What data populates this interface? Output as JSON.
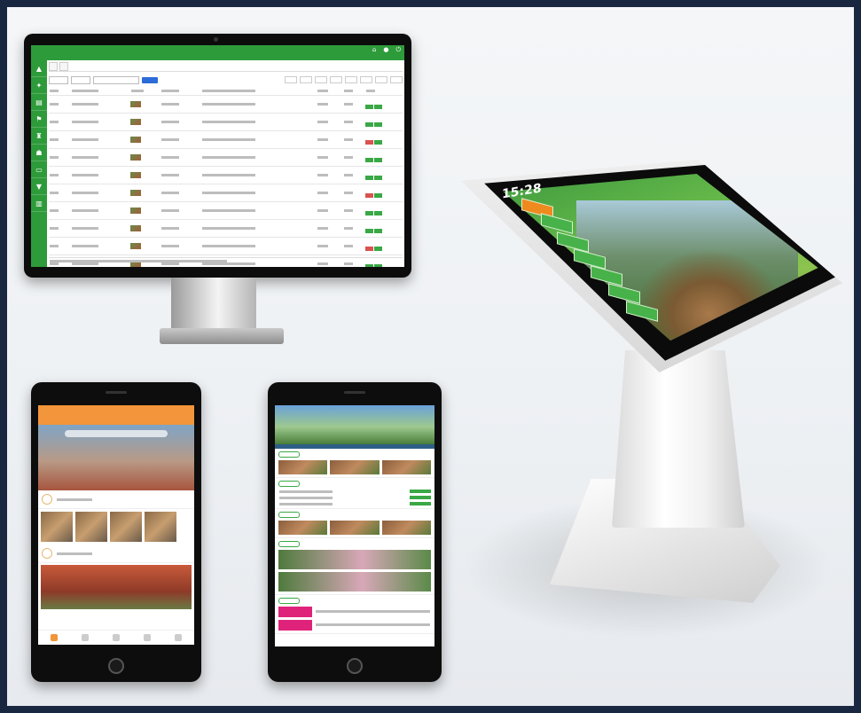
{
  "monitor": {
    "app_title": "",
    "tabs": [],
    "row_count": 12
  },
  "kiosk": {
    "time": "15:28",
    "date": "",
    "menu_buttons": 6
  },
  "phone_left": {
    "header_title": "",
    "sections": 2,
    "nav_items": 5
  },
  "phone_right": {
    "sections": 4
  }
}
